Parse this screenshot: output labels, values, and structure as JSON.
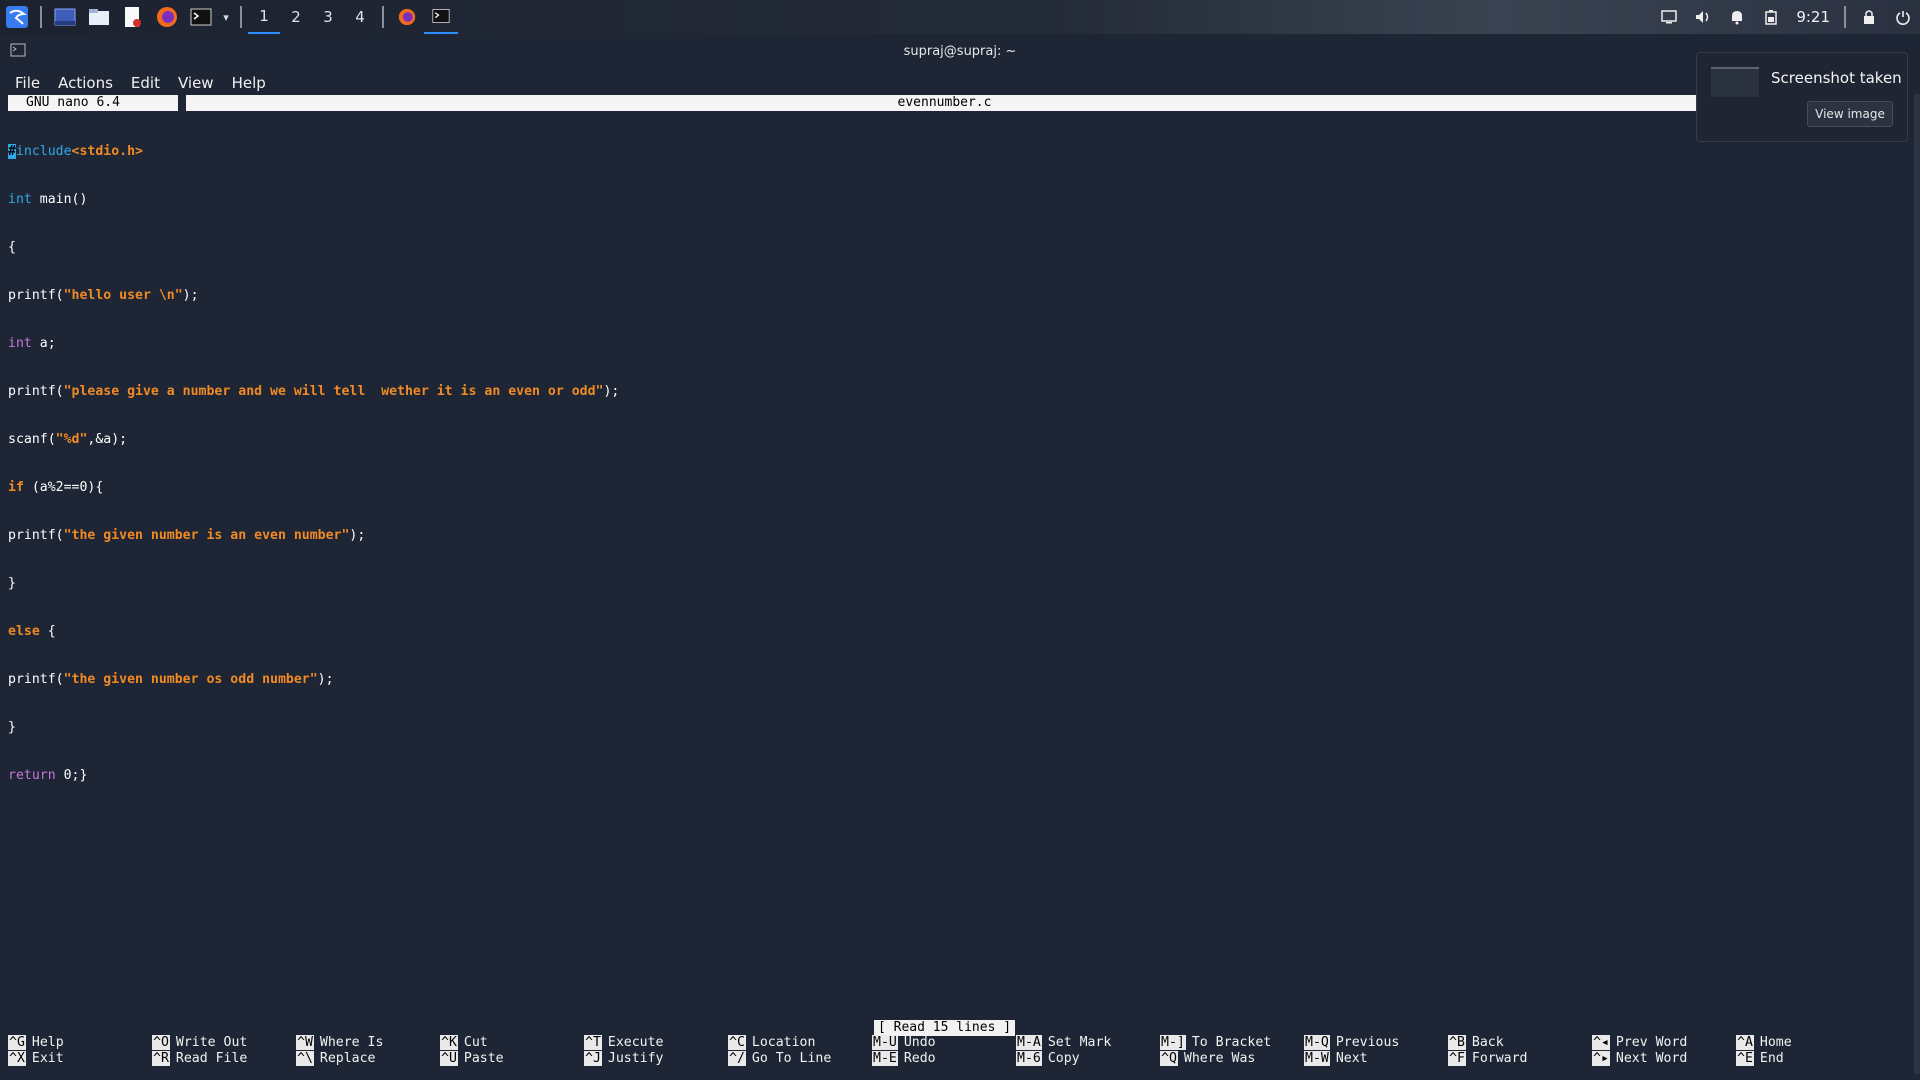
{
  "taskbar": {
    "workspaces": [
      "1",
      "2",
      "3",
      "4"
    ],
    "active_workspace": "1",
    "clock": "9:21",
    "launcher_icons": [
      "kali-menu-icon",
      "show-desktop-icon",
      "file-manager-icon",
      "text-editor-icon",
      "firefox-icon",
      "terminal-icon"
    ],
    "tray_icons": [
      "display-icon",
      "volume-icon",
      "notifications-icon",
      "battery-icon",
      "lock-icon",
      "power-icon"
    ]
  },
  "window": {
    "title": "supraj@supraj: ~",
    "menu": [
      "File",
      "Actions",
      "Edit",
      "View",
      "Help"
    ]
  },
  "nano": {
    "version": "GNU nano 6.4",
    "filename": "evennumber.c",
    "status": "[ Read 15 lines ]"
  },
  "code": {
    "l1_inc": "#include",
    "l1_hdr": "<stdio.h>",
    "l2_kw": "int",
    "l2_rest": " main()",
    "l3": "{",
    "l4_a": "printf(",
    "l4_s": "\"hello user \\n\"",
    "l4_b": ");",
    "l5_kw": "int",
    "l5_rest": " a;",
    "l6_a": "printf(",
    "l6_s": "\"please give a number and we will tell  wether it is an even or odd\"",
    "l6_b": ");",
    "l7_a": "scanf(",
    "l7_s": "\"%d\"",
    "l7_b": ",&a);",
    "l8_kw": "if",
    "l8_rest": " (a%2==0){",
    "l9_a": "printf(",
    "l9_s": "\"the given number is an even number\"",
    "l9_b": ");",
    "l10": "}",
    "l11_kw": "else",
    "l11_rest": " {",
    "l12_a": "printf(",
    "l12_s": "\"the given number os odd number\"",
    "l12_b": ");",
    "l13": "}",
    "l14_kw": "return",
    "l14_rest": " 0;}"
  },
  "shortcuts": [
    {
      "k1": "^G",
      "l1": "Help",
      "k2": "^X",
      "l2": "Exit"
    },
    {
      "k1": "^O",
      "l1": "Write Out",
      "k2": "^R",
      "l2": "Read File"
    },
    {
      "k1": "^W",
      "l1": "Where Is",
      "k2": "^\\",
      "l2": "Replace"
    },
    {
      "k1": "^K",
      "l1": "Cut",
      "k2": "^U",
      "l2": "Paste"
    },
    {
      "k1": "^T",
      "l1": "Execute",
      "k2": "^J",
      "l2": "Justify"
    },
    {
      "k1": "^C",
      "l1": "Location",
      "k2": "^/",
      "l2": "Go To Line"
    },
    {
      "k1": "M-U",
      "l1": "Undo",
      "k2": "M-E",
      "l2": "Redo"
    },
    {
      "k1": "M-A",
      "l1": "Set Mark",
      "k2": "M-6",
      "l2": "Copy"
    },
    {
      "k1": "M-]",
      "l1": "To Bracket",
      "k2": "^Q",
      "l2": "Where Was"
    },
    {
      "k1": "M-Q",
      "l1": "Previous",
      "k2": "M-W",
      "l2": "Next"
    },
    {
      "k1": "^B",
      "l1": "Back",
      "k2": "^F",
      "l2": "Forward"
    },
    {
      "k1": "^◂",
      "l1": "Prev Word",
      "k2": "^▸",
      "l2": "Next Word"
    },
    {
      "k1": "^A",
      "l1": "Home",
      "k2": "^E",
      "l2": "End"
    }
  ],
  "notification": {
    "title": "Screenshot taken",
    "button": "View image"
  }
}
